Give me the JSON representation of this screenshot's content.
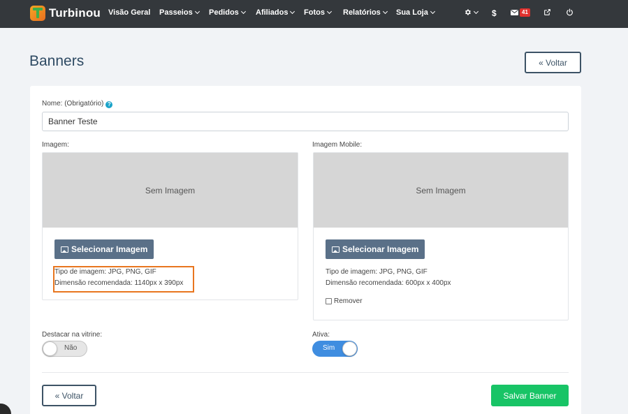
{
  "brand": {
    "name": "Turbinou"
  },
  "nav": {
    "items": [
      {
        "label": "Visão Geral",
        "dropdown": false
      },
      {
        "label": "Passeios",
        "dropdown": true
      },
      {
        "label": "Pedidos",
        "dropdown": true
      },
      {
        "label": "Afiliados",
        "dropdown": true
      },
      {
        "label": "Fotos",
        "dropdown": true
      },
      {
        "label": "Relatórios",
        "dropdown": true
      },
      {
        "label": "Sua Loja",
        "dropdown": true
      }
    ],
    "icons": {
      "settings": "gear-icon",
      "finance": "$",
      "messages_icon": "envelope-icon",
      "messages_count": "41",
      "external": "external-link-icon",
      "power": "power-icon"
    }
  },
  "page": {
    "title": "Banners",
    "back_label": "« Voltar"
  },
  "form": {
    "name_label": "Nome: (Obrigatório)",
    "help_icon": "?",
    "name_value": "Banner Teste",
    "image": {
      "label": "Imagem:",
      "placeholder": "Sem Imagem",
      "select_label": "Selecionar Imagem",
      "type_info": "Tipo de imagem: JPG, PNG, GIF",
      "dimension_info": "Dimensão recomendada: 1140px x 390px"
    },
    "image_mobile": {
      "label": "Imagem Mobile:",
      "placeholder": "Sem Imagem",
      "select_label": "Selecionar Imagem",
      "type_info": "Tipo de imagem: JPG, PNG, GIF",
      "dimension_info": "Dimensão recomendada: 600px x 400px",
      "remove_label": "Remover",
      "remove_checked": false
    },
    "featured": {
      "label": "Destacar na vitrine:",
      "value": "Não",
      "on": false
    },
    "active": {
      "label": "Ativa:",
      "value": "Sim",
      "on": true
    },
    "footer": {
      "back_label": "« Voltar",
      "save_label": "Salvar Banner"
    }
  },
  "colors": {
    "navbar": "#34383c",
    "save": "#18c466",
    "select_button": "#5a7088",
    "toggle_on": "#3f8de0",
    "highlight": "#e8761f"
  }
}
